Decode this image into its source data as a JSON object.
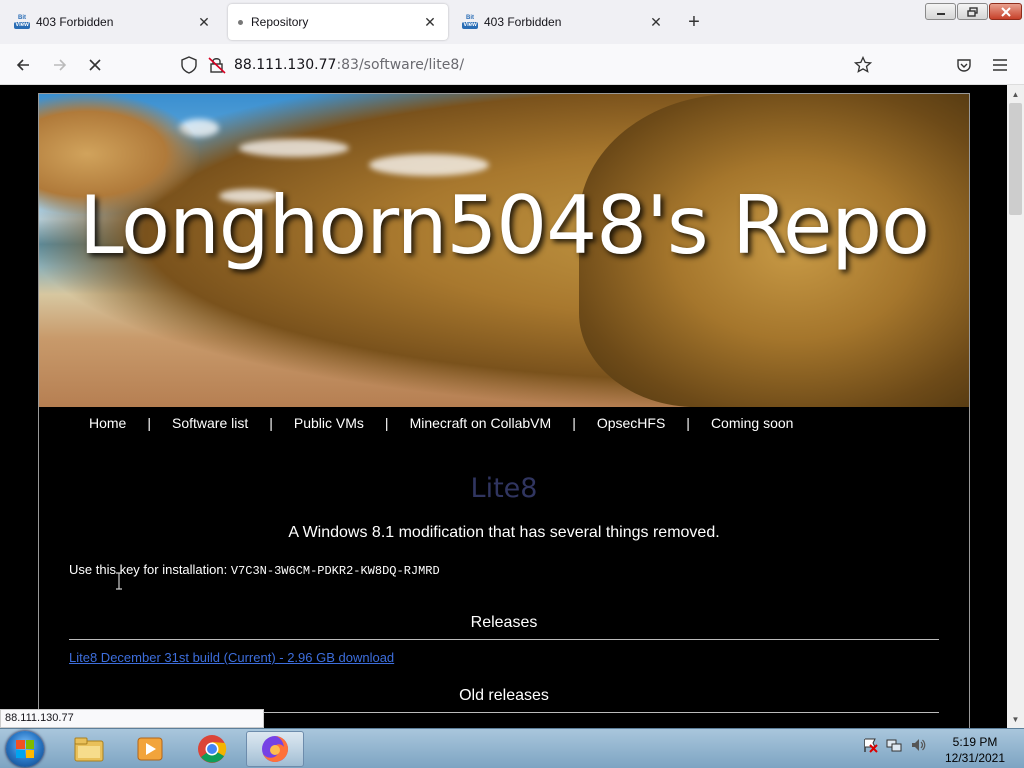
{
  "tabs": [
    {
      "title": "403 Forbidden",
      "favicon": "bitview-favicon",
      "active": false
    },
    {
      "title": "Repository",
      "favicon": "loading-dot",
      "active": true
    },
    {
      "title": "403 Forbidden",
      "favicon": "bitview-favicon",
      "active": false
    }
  ],
  "favicon_text": {
    "line1": "Bit",
    "line2": "View"
  },
  "address_bar": {
    "host": "88.111.130.77",
    "path": ":83/software/lite8/"
  },
  "site": {
    "title": "Longhorn5048's Repo",
    "nav": [
      "Home",
      "Software list",
      "Public VMs",
      "Minecraft on CollabVM",
      "OpsecHFS",
      "Coming soon"
    ],
    "separator": "|"
  },
  "product": {
    "name": "Lite8",
    "description": "A Windows 8.1 modification that has several things removed.",
    "key_label": "Use this key for installation: ",
    "key": "V7C3N-3W6CM-PDKR2-KW8DQ-RJMRD"
  },
  "releases": {
    "heading": "Releases",
    "current_link": "Lite8 December 31st build (Current) - 2.96 GB download",
    "old_heading": "Old releases"
  },
  "status_url": "88.111.130.77",
  "taskbar": {
    "apps": [
      "file-explorer",
      "media-player",
      "chrome",
      "firefox"
    ],
    "active_app": "firefox"
  },
  "clock": {
    "time": "5:19 PM",
    "date": "12/31/2021"
  },
  "colors": {
    "page_background": "#000000",
    "product_title": "#303560",
    "link": "#3d6edc",
    "tab_strip": "#f0f0f4"
  }
}
